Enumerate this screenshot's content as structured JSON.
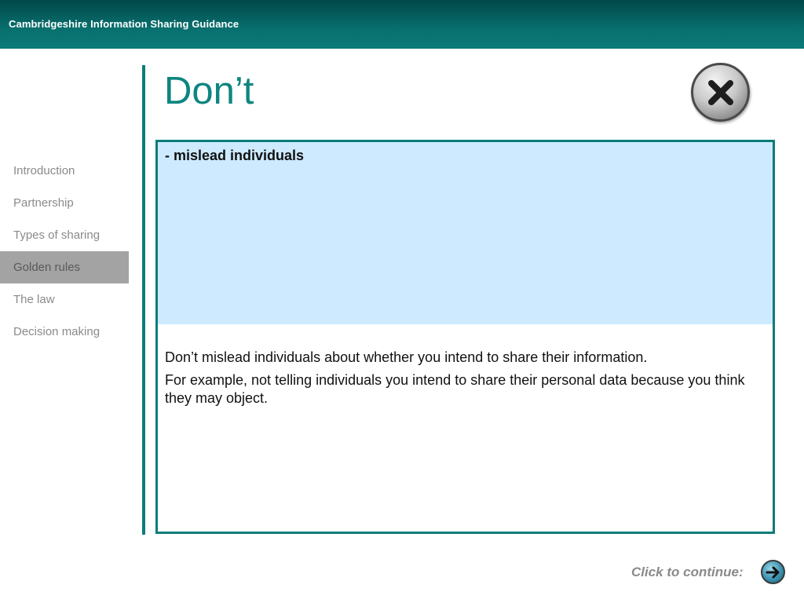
{
  "header": {
    "title": "Cambridgeshire Information Sharing Guidance"
  },
  "nav": {
    "items": [
      {
        "label": "Introduction"
      },
      {
        "label": "Partnership"
      },
      {
        "label": "Types of sharing"
      },
      {
        "label": "Golden rules"
      },
      {
        "label": "The law"
      },
      {
        "label": "Decision making"
      }
    ],
    "active_label": "Golden rules"
  },
  "page": {
    "title": "Don’t",
    "close_icon": "close-x-icon"
  },
  "content": {
    "highlight": "- mislead individuals",
    "paragraphs": [
      "Don’t mislead individuals about whether you intend to share their information.",
      "For example, not telling individuals you intend to share their personal data because you think they may object."
    ]
  },
  "footer": {
    "continue_label": "Click to continue:",
    "continue_icon": "arrow-right-icon"
  },
  "colors": {
    "accent": "#0b7d7a",
    "highlight_bg": "#cdeaff",
    "nav_active_bg": "#a3a3a3"
  }
}
